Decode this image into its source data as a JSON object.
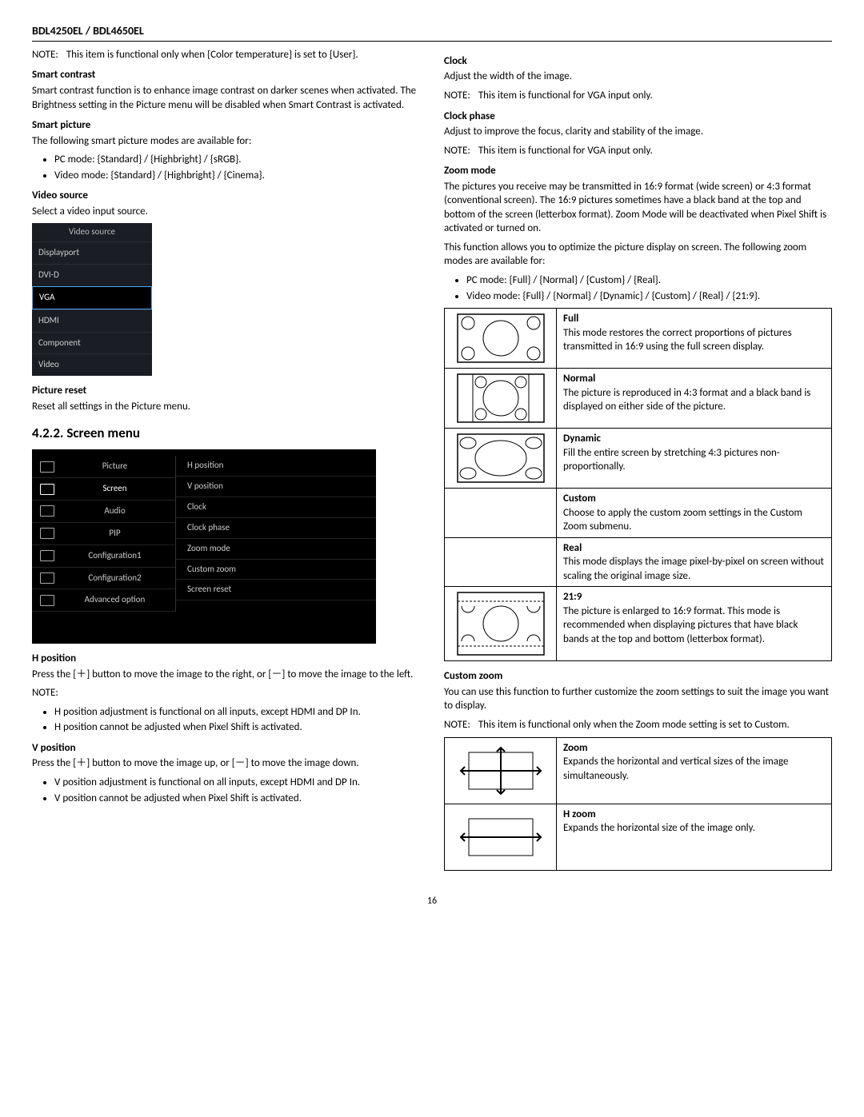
{
  "header": "BDL4250EL / BDL4650EL",
  "note1": {
    "lbl": "NOTE:",
    "txt": "This item is functional only when {Color temperature} is set to {User}."
  },
  "smart_contrast": {
    "title": "Smart contrast",
    "txt": "Smart contrast function is to enhance image contrast on darker scenes when activated. The Brightness setting in the Picture menu will be disabled when Smart Contrast is activated."
  },
  "smart_picture": {
    "title": "Smart picture",
    "txt": "The following smart picture modes are available for:",
    "items": [
      "PC mode: {Standard} / {Highbright} / {sRGB}.",
      "Video mode: {Standard} / {Highbright} / {Cinema}."
    ]
  },
  "video_source": {
    "title": "Video source",
    "txt": "Select a video input source.",
    "menu_title": "Video source",
    "items": [
      "Displayport",
      "DVI-D",
      "VGA",
      "HDMI",
      "Component",
      "Video"
    ],
    "selected": "VGA"
  },
  "picture_reset": {
    "title": "Picture reset",
    "txt": "Reset all settings in the Picture menu."
  },
  "screen_menu_heading": "4.2.2.  Screen menu",
  "osd": {
    "left": [
      "Picture",
      "Screen",
      "Audio",
      "PIP",
      "Configuration1",
      "Configuration2",
      "Advanced option"
    ],
    "selected": "Screen",
    "right": [
      "H position",
      "V position",
      "Clock",
      "Clock phase",
      "Zoom mode",
      "Custom zoom",
      "Screen reset"
    ]
  },
  "h_position": {
    "title": "H position",
    "txt": "Press the [＋] button to move the image to the right, or [－] to move the image to the left.",
    "note_lbl": "NOTE:",
    "items": [
      "H position adjustment is functional on all inputs, except HDMI and DP In.",
      "H position cannot be adjusted when Pixel Shift is activated."
    ]
  },
  "v_position": {
    "title": "V position",
    "txt": "Press the [＋] button to move the image up, or [－] to move the image down.",
    "items": [
      "V position adjustment is functional on all inputs, except HDMI and DP In.",
      "V position cannot be adjusted when Pixel Shift is activated."
    ]
  },
  "clock": {
    "title": "Clock",
    "txt": "Adjust the width of the image.",
    "note_lbl": "NOTE:",
    "note_txt": "This item is functional for VGA input only."
  },
  "clock_phase": {
    "title": "Clock phase",
    "txt": "Adjust to improve the focus, clarity and stability of the image.",
    "note_lbl": "NOTE:",
    "note_txt": "This item is functional for VGA input only."
  },
  "zoom_mode": {
    "title": "Zoom mode",
    "p1": "The pictures you receive may be transmitted in 16:9 format (wide screen) or 4:3 format (conventional screen). The 16:9 pictures sometimes have a black band at the top and bottom of the screen (letterbox format). Zoom Mode will be deactivated when Pixel Shift is activated or turned on.",
    "p2": "This function allows you to optimize the picture display on screen. The following zoom modes are available for:",
    "items": [
      "PC mode: {Full} / {Normal} / {Custom} / {Real}.",
      "Video mode: {Full} / {Normal} / {Dynamic} / {Custom} / {Real} / {21:9}."
    ],
    "modes": {
      "full": {
        "t": "Full",
        "d": "This mode restores the correct proportions of pictures transmitted in 16:9 using the full screen display."
      },
      "normal": {
        "t": "Normal",
        "d": "The picture is reproduced in 4:3 format and a black band is displayed on either side of the picture."
      },
      "dynamic": {
        "t": "Dynamic",
        "d": "Fill the entire screen by stretching 4:3 pictures non-proportionally."
      },
      "custom": {
        "t": "Custom",
        "d": "Choose to apply the custom zoom settings in the Custom Zoom submenu."
      },
      "real": {
        "t": "Real",
        "d": "This mode displays the image pixel-by-pixel on screen without scaling the original image size."
      },
      "r219": {
        "t": "21:9",
        "d": "The picture is enlarged to 16:9 format. This mode is recommended when displaying pictures that have black bands at the top and bottom (letterbox format)."
      }
    }
  },
  "custom_zoom": {
    "title": "Custom zoom",
    "txt": "You can use this function to further customize the zoom settings to suit the image you want to display.",
    "note_lbl": "NOTE:",
    "note_txt": "This item is functional only when the Zoom mode setting is set to Custom.",
    "rows": {
      "zoom": {
        "t": "Zoom",
        "d": "Expands the horizontal and vertical sizes of the image simultaneously."
      },
      "hzoom": {
        "t": "H zoom",
        "d": "Expands the horizontal size of the image only."
      }
    }
  },
  "page_number": "16"
}
